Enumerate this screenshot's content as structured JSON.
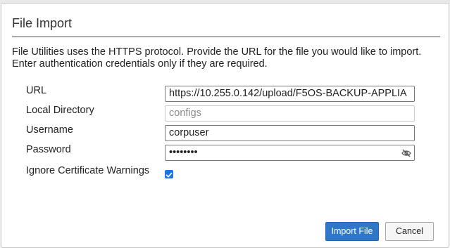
{
  "dialog": {
    "title": "File Import",
    "description": "File Utilities uses the HTTPS protocol. Provide the URL for the file you would like to import. Enter authentication credentials only if they are required."
  },
  "form": {
    "url_label": "URL",
    "url_value": "https://10.255.0.142/upload/F5OS-BACKUP-APPLIA",
    "local_directory_label": "Local Directory",
    "local_directory_placeholder": "configs",
    "username_label": "Username",
    "username_value": "corpuser",
    "password_label": "Password",
    "password_value": "••••••••",
    "ignore_cert_label": "Ignore Certificate Warnings",
    "ignore_cert_checked": true
  },
  "buttons": {
    "import_label": "Import File",
    "cancel_label": "Cancel"
  },
  "colors": {
    "primary": "#2f78c9",
    "checkbox": "#1a73e8"
  },
  "icons": {
    "password_toggle": "eye-slash-icon",
    "checkbox_mark": "checkmark-icon"
  }
}
